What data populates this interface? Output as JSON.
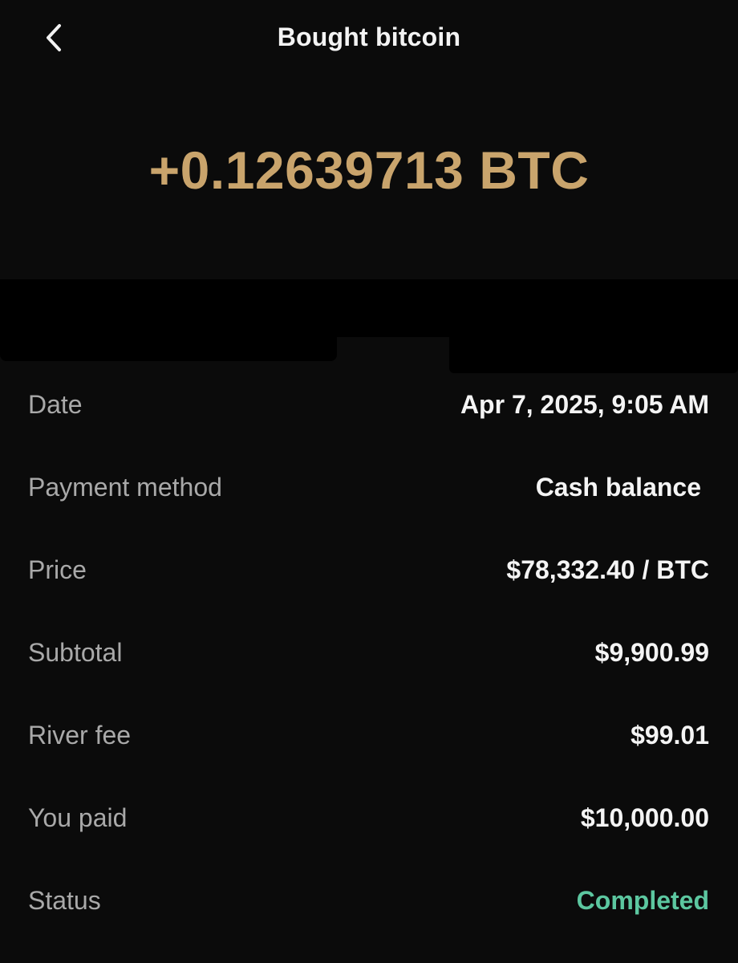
{
  "header": {
    "back_icon": "chevron-left-icon",
    "title": "Bought bitcoin"
  },
  "transaction": {
    "amount": "+0.12639713 BTC"
  },
  "colors": {
    "background": "#0b0b0b",
    "amount": "#c9a46c",
    "label": "#a9a9a9",
    "value": "#f4f4f4",
    "status_completed": "#5cc7a0"
  },
  "details": [
    {
      "label": "Date",
      "value": "Apr 7, 2025, 9:05 AM"
    },
    {
      "label": "Payment method",
      "value": "Cash balance"
    },
    {
      "label": "Price",
      "value": "$78,332.40 / BTC"
    },
    {
      "label": "Subtotal",
      "value": "$9,900.99"
    },
    {
      "label": "River fee",
      "value": "$99.01"
    },
    {
      "label": "You paid",
      "value": "$10,000.00"
    },
    {
      "label": "Status",
      "value": "Completed"
    }
  ]
}
